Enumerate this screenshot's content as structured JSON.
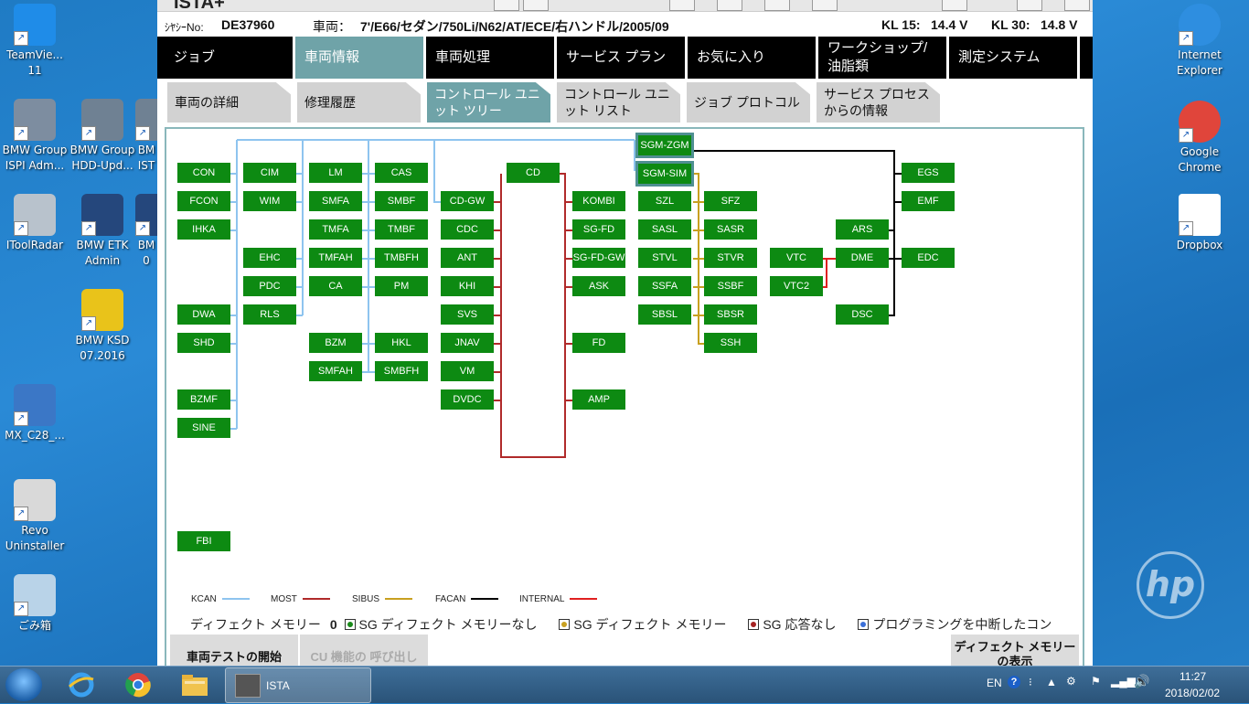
{
  "desktop_left": [
    {
      "label": "TeamVie...\n11",
      "color": "#1f8ce8"
    },
    {
      "label": "BMW Group ISPI Adm...",
      "color": "#7d8da0"
    },
    {
      "label": "BMW Group HDD-Upd...",
      "color": "#6f8193"
    },
    {
      "label": "BM IST",
      "color": "#6f8193"
    },
    {
      "label": "IToolRadar",
      "color": "#b8c2cc"
    },
    {
      "label": "BMW ETK Admin",
      "color": "#25477c"
    },
    {
      "label": "BM 0",
      "color": "#25477c"
    },
    {
      "label": "BMW KSD 07.2016",
      "color": "#e9c31a"
    },
    {
      "label": "MX_C28_...",
      "color": "#3b77c6"
    },
    {
      "label": "Revo Uninstaller",
      "color": "#d9d9d9"
    },
    {
      "label": "ごみ箱",
      "color": "#b9d3e8"
    }
  ],
  "desktop_right": [
    {
      "label": "Internet Explorer",
      "color": "#2e8ee0"
    },
    {
      "label": "Google Chrome",
      "color": "#e0453b"
    },
    {
      "label": "Dropbox",
      "color": "#ffffff"
    }
  ],
  "hp_logo": "hp",
  "app": {
    "title": "ISTA+",
    "vin_label": "ｼﾔｼｰNo:",
    "vin": "DE37960",
    "vehicle_label": "車両：",
    "vehicle": "7'/E66/セダン/750Li/N62/AT/ECE/右ハンドル/2005/09",
    "kl15_label": "KL 15:",
    "kl15": "14.4 V",
    "kl30_label": "KL 30:",
    "kl30": "14.8 V"
  },
  "nav_main": [
    "ジョブ",
    "車両情報",
    "車両処理",
    "サービス プラン",
    "お気に入り",
    "ワークショップ/ 油脂類",
    "測定システム"
  ],
  "nav_sub": [
    "車両の詳細",
    "修理履歴",
    "コントロール ユニット ツリー",
    "コントロール ユニット リスト",
    "ジョブ プロトコル",
    "サービス プロセス からの情報"
  ],
  "ecus": [
    "CON",
    "FCON",
    "IHKA",
    "DWA",
    "SHD",
    "BZMF",
    "SINE",
    "FBI",
    "CIM",
    "WIM",
    "EHC",
    "PDC",
    "RLS",
    "LM",
    "SMFA",
    "TMFA",
    "TMFAH",
    "CA",
    "BZM",
    "SMFAH",
    "CAS",
    "SMBF",
    "TMBF",
    "TMBFH",
    "PM",
    "HKL",
    "SMBFH",
    "CD-GW",
    "CDC",
    "ANT",
    "KHI",
    "SVS",
    "JNAV",
    "VM",
    "DVDC",
    "CD",
    "KOMBI",
    "SG-FD",
    "SG-FD-GW",
    "ASK",
    "FD",
    "AMP",
    "SGM-ZGM",
    "SGM-SIM",
    "SZL",
    "SASL",
    "STVL",
    "SSFA",
    "SBSL",
    "SFZ",
    "SASR",
    "STVR",
    "SSBF",
    "SBSR",
    "SSH",
    "VTC",
    "VTC2",
    "ARS",
    "DME",
    "DSC",
    "EGS",
    "EMF",
    "EDC"
  ],
  "legend": [
    {
      "name": "KCAN",
      "color": "#8ec4ef"
    },
    {
      "name": "MOST",
      "color": "#b02a2a"
    },
    {
      "name": "SIBUS",
      "color": "#c8a020"
    },
    {
      "name": "FACAN",
      "color": "#000000"
    },
    {
      "name": "INTERNAL",
      "color": "#e02020"
    }
  ],
  "status": {
    "defect_label": "ディフェクト メモリー",
    "defect_count": "0",
    "items": [
      {
        "text": "SG ディフェクト メモリーなし",
        "color": "#1a8a1a"
      },
      {
        "text": "SG ディフェクト メモリー",
        "color": "#c8a020"
      },
      {
        "text": "SG 応答なし",
        "color": "#a52222"
      },
      {
        "text": "プログラミングを中断したコン",
        "color": "#3a6fd8"
      }
    ]
  },
  "buttons": {
    "start_test": "車両テストの開始",
    "cu_call": "CU 機能の 呼び出し",
    "defect_show": "ディフェクト メモリーの表示"
  },
  "taskbar": {
    "task_label": "ISTA",
    "lang": "EN",
    "time": "11:27",
    "date": "2018/02/02"
  }
}
